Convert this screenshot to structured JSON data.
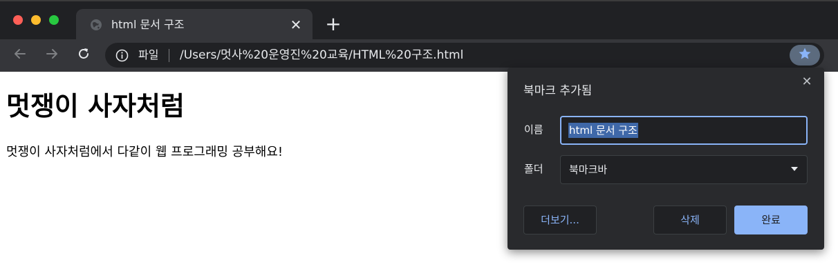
{
  "colors": {
    "chrome_dark": "#202124",
    "chrome_toolbar": "#35363a",
    "accent_blue": "#8ab4f8",
    "traffic_red": "#fe5f57",
    "traffic_yellow": "#febc2e",
    "traffic_green": "#28c840"
  },
  "browser": {
    "tab": {
      "title": "html 문서 구조",
      "favicon": "globe-icon",
      "close_icon": "close-icon",
      "close_glyph": "✕"
    },
    "new_tab_glyph": "+",
    "toolbar": {
      "back_icon": "arrow-left-icon",
      "forward_icon": "arrow-right-icon",
      "reload_icon": "reload-icon",
      "scheme_icon": "info-icon",
      "scheme_label": "파일",
      "url": "/Users/멋사%20운영진%20교육/HTML%20구조.html",
      "bookmark_icon": "star-icon"
    }
  },
  "page": {
    "heading": "멋쟁이 사자처럼",
    "paragraph": "멋쟁이 사자처럼에서 다같이 웹 프로그래밍 공부해요!"
  },
  "bookmark_dialog": {
    "title": "북마크 추가됨",
    "close_glyph": "✕",
    "name_label": "이름",
    "name_value": "html 문서 구조",
    "folder_label": "폴더",
    "folder_value": "북마크바",
    "more_button": "더보기...",
    "delete_button": "삭제",
    "done_button": "완료"
  }
}
